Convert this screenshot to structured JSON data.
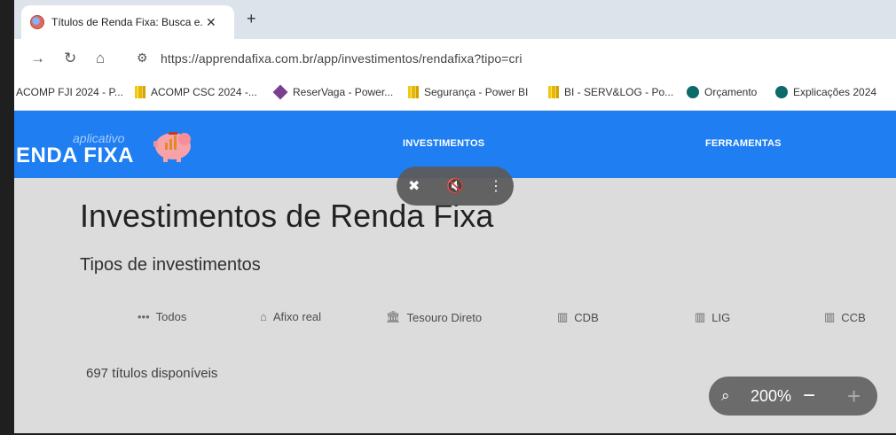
{
  "tab": {
    "title": "Títulos de Renda Fixa: Busca e...",
    "close": "✕"
  },
  "new_tab": "+",
  "toolbar": {
    "url": "https://apprendafixa.com.br/app/investimentos/rendafixa?tipo=cri"
  },
  "bookmarks": [
    {
      "label": "ACOMP FJI 2024 - P...",
      "icon": "none"
    },
    {
      "label": "ACOMP CSC 2024 -...",
      "icon": "powerbi-icon"
    },
    {
      "label": "ReserVaga - Power...",
      "icon": "diamond-icon"
    },
    {
      "label": "Segurança - Power BI",
      "icon": "powerbi-icon"
    },
    {
      "label": "BI - SERV&LOG - Po...",
      "icon": "powerbi-icon"
    },
    {
      "label": "Orçamento",
      "icon": "sharepoint-icon"
    },
    {
      "label": "Explicações 2024",
      "icon": "sharepoint-icon"
    }
  ],
  "site": {
    "logo_small": "aplicativo",
    "logo_main": "ENDA FIXA",
    "nav": [
      "INVESTIMENTOS",
      "FERRAMENTAS"
    ]
  },
  "main": {
    "title": "Investimentos de Renda Fixa",
    "section": "Tipos de investimentos",
    "filters": [
      {
        "label": "Todos",
        "icon": "dots-icon"
      },
      {
        "label": "Afixo real",
        "icon": "home-icon"
      },
      {
        "label": "Tesouro Direto",
        "icon": "bank-icon"
      },
      {
        "label": "CDB",
        "icon": "building-icon"
      },
      {
        "label": "LIG",
        "icon": "building-icon"
      },
      {
        "label": "CCB",
        "icon": "building-icon"
      }
    ],
    "available": "697 títulos disponíveis"
  },
  "zoom": {
    "value": "200%"
  },
  "colors": {
    "brand_blue": "#1e7ef2",
    "tab_strip": "#dde3ea"
  }
}
